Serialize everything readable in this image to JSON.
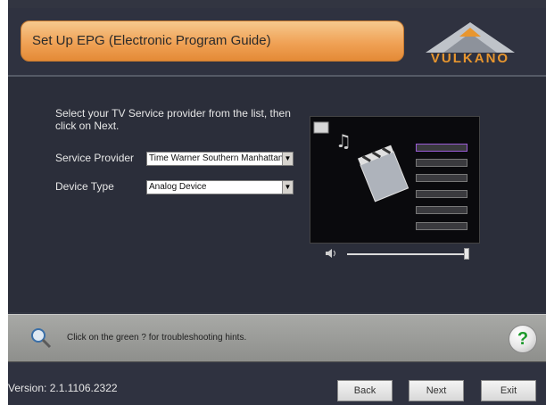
{
  "header": {
    "title": "Set Up EPG (Electronic Program Guide)",
    "logo_text": "VULKANO"
  },
  "instructions": "Select your TV Service provider from the list, then click on Next.",
  "form": {
    "service_provider_label": "Service Provider",
    "service_provider_value": "Time Warner Southern Manhattan",
    "device_type_label": "Device Type",
    "device_type_value": "Analog Device"
  },
  "help": {
    "hint": "Click on the green ? for troubleshooting hints.",
    "button_label": "?"
  },
  "footer": {
    "version": "Version: 2.1.1106.2322",
    "back_label": "Back",
    "next_label": "Next",
    "exit_label": "Exit"
  },
  "preview": {
    "volume_level": 1.0
  },
  "colors": {
    "accent_orange": "#f0a256",
    "help_green": "#1c9a2b",
    "background": "#323541"
  },
  "icons": [
    "logo-triangle-icon",
    "speaker-icon",
    "magnifier-icon",
    "help-icon",
    "select-arrow-icon"
  ]
}
